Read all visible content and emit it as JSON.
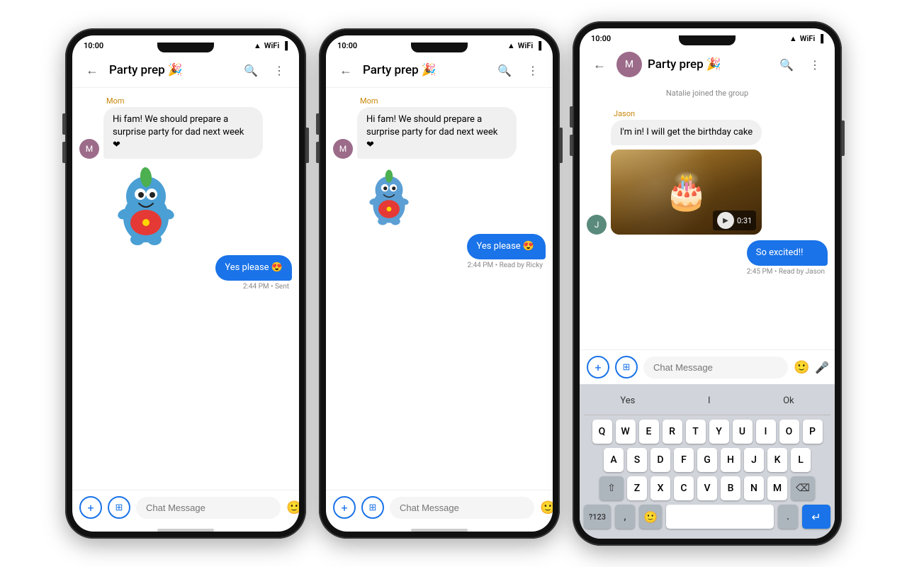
{
  "phones": [
    {
      "id": "phone-1",
      "statusBar": {
        "time": "10:00",
        "signal": "▲▼",
        "wifi": "WiFi",
        "battery": "🔋"
      },
      "appBar": {
        "title": "Party prep",
        "emoji": "🎉",
        "backLabel": "←",
        "searchLabel": "🔍",
        "moreLabel": "⋮"
      },
      "messages": [
        {
          "type": "received",
          "sender": "Mom",
          "text": "Hi fam! We should prepare a surprise party for dad next week ❤",
          "avatar": "M",
          "avatarColor": "#9c6b8a"
        },
        {
          "type": "sticker",
          "size": "large"
        },
        {
          "type": "sent",
          "text": "Yes please 😍",
          "time": "2:44 PM • Sent"
        }
      ],
      "inputBar": {
        "placeholder": "Chat Message"
      }
    },
    {
      "id": "phone-2",
      "statusBar": {
        "time": "10:00"
      },
      "appBar": {
        "title": "Party prep",
        "emoji": "🎉"
      },
      "messages": [
        {
          "type": "received",
          "sender": "Mom",
          "text": "Hi fam! We should prepare a surprise party for dad next week ❤",
          "avatar": "M",
          "avatarColor": "#9c6b8a"
        },
        {
          "type": "sticker",
          "size": "small"
        },
        {
          "type": "sent",
          "text": "Yes please 😍",
          "time": "2:44 PM • Read by Ricky"
        }
      ],
      "inputBar": {
        "placeholder": "Chat Message"
      }
    },
    {
      "id": "phone-3",
      "statusBar": {
        "time": "10:00"
      },
      "appBar": {
        "title": "Party prep",
        "emoji": "🎉"
      },
      "joinNotice": "Natalie joined the group",
      "messages": [
        {
          "type": "received",
          "sender": "Jason",
          "senderColor": "#c8860a",
          "text": "I'm in! I will get the birthday cake",
          "hasVideo": true,
          "videoDuration": "0:31",
          "avatar": "J",
          "avatarColor": "#5a8a7c"
        },
        {
          "type": "sent",
          "text": "So excited!!",
          "time": "2:45 PM • Read by Jason"
        }
      ],
      "inputBar": {
        "placeholder": "Chat Message"
      },
      "keyboard": {
        "suggestions": [
          "Yes",
          "I",
          "Ok"
        ],
        "rows": [
          [
            "Q",
            "W",
            "E",
            "R",
            "T",
            "Y",
            "U",
            "I",
            "O",
            "P"
          ],
          [
            "A",
            "S",
            "D",
            "F",
            "G",
            "H",
            "J",
            "K",
            "L"
          ],
          [
            "Z",
            "X",
            "C",
            "V",
            "B",
            "N",
            "M"
          ]
        ],
        "bottomRow": [
          "?123",
          ",",
          "emoji",
          "space",
          ".",
          "enter"
        ]
      }
    }
  ]
}
